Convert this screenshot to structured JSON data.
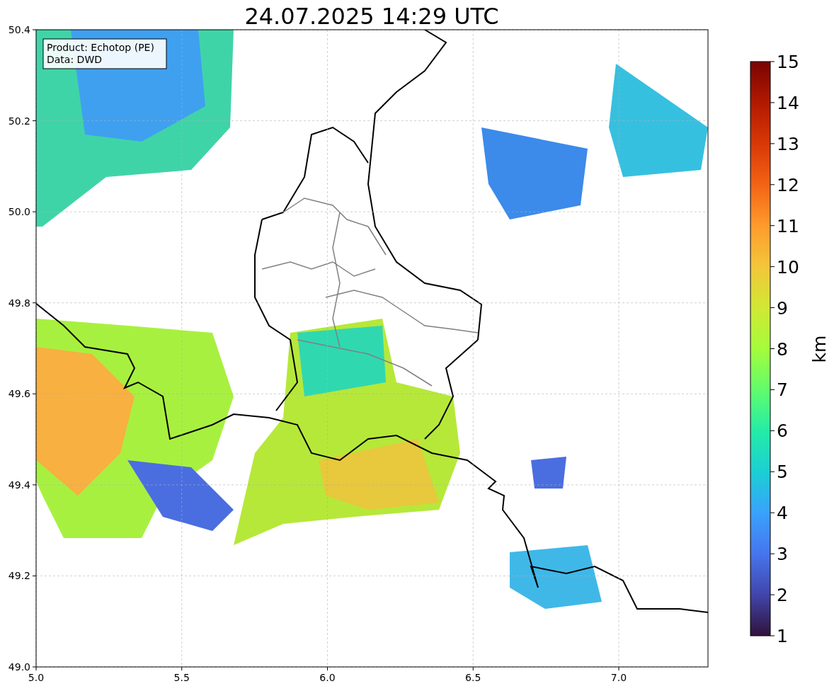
{
  "title": "24.07.2025 14:29 UTC",
  "info_box": {
    "lines": [
      "Product: Echotop (PE)",
      "Data: DWD"
    ]
  },
  "x_ticks": [
    "5.0",
    "5.5",
    "6.0",
    "6.5",
    "7.0"
  ],
  "y_ticks": [
    "50.4",
    "50.2",
    "50.0",
    "49.8",
    "49.6",
    "49.4",
    "49.2",
    "49.0"
  ],
  "colorbar": {
    "label": "km",
    "ticks": [
      "15",
      "14",
      "13",
      "12",
      "11",
      "10",
      "9",
      "8",
      "7",
      "6",
      "5",
      "4",
      "3",
      "2",
      "1"
    ]
  }
}
